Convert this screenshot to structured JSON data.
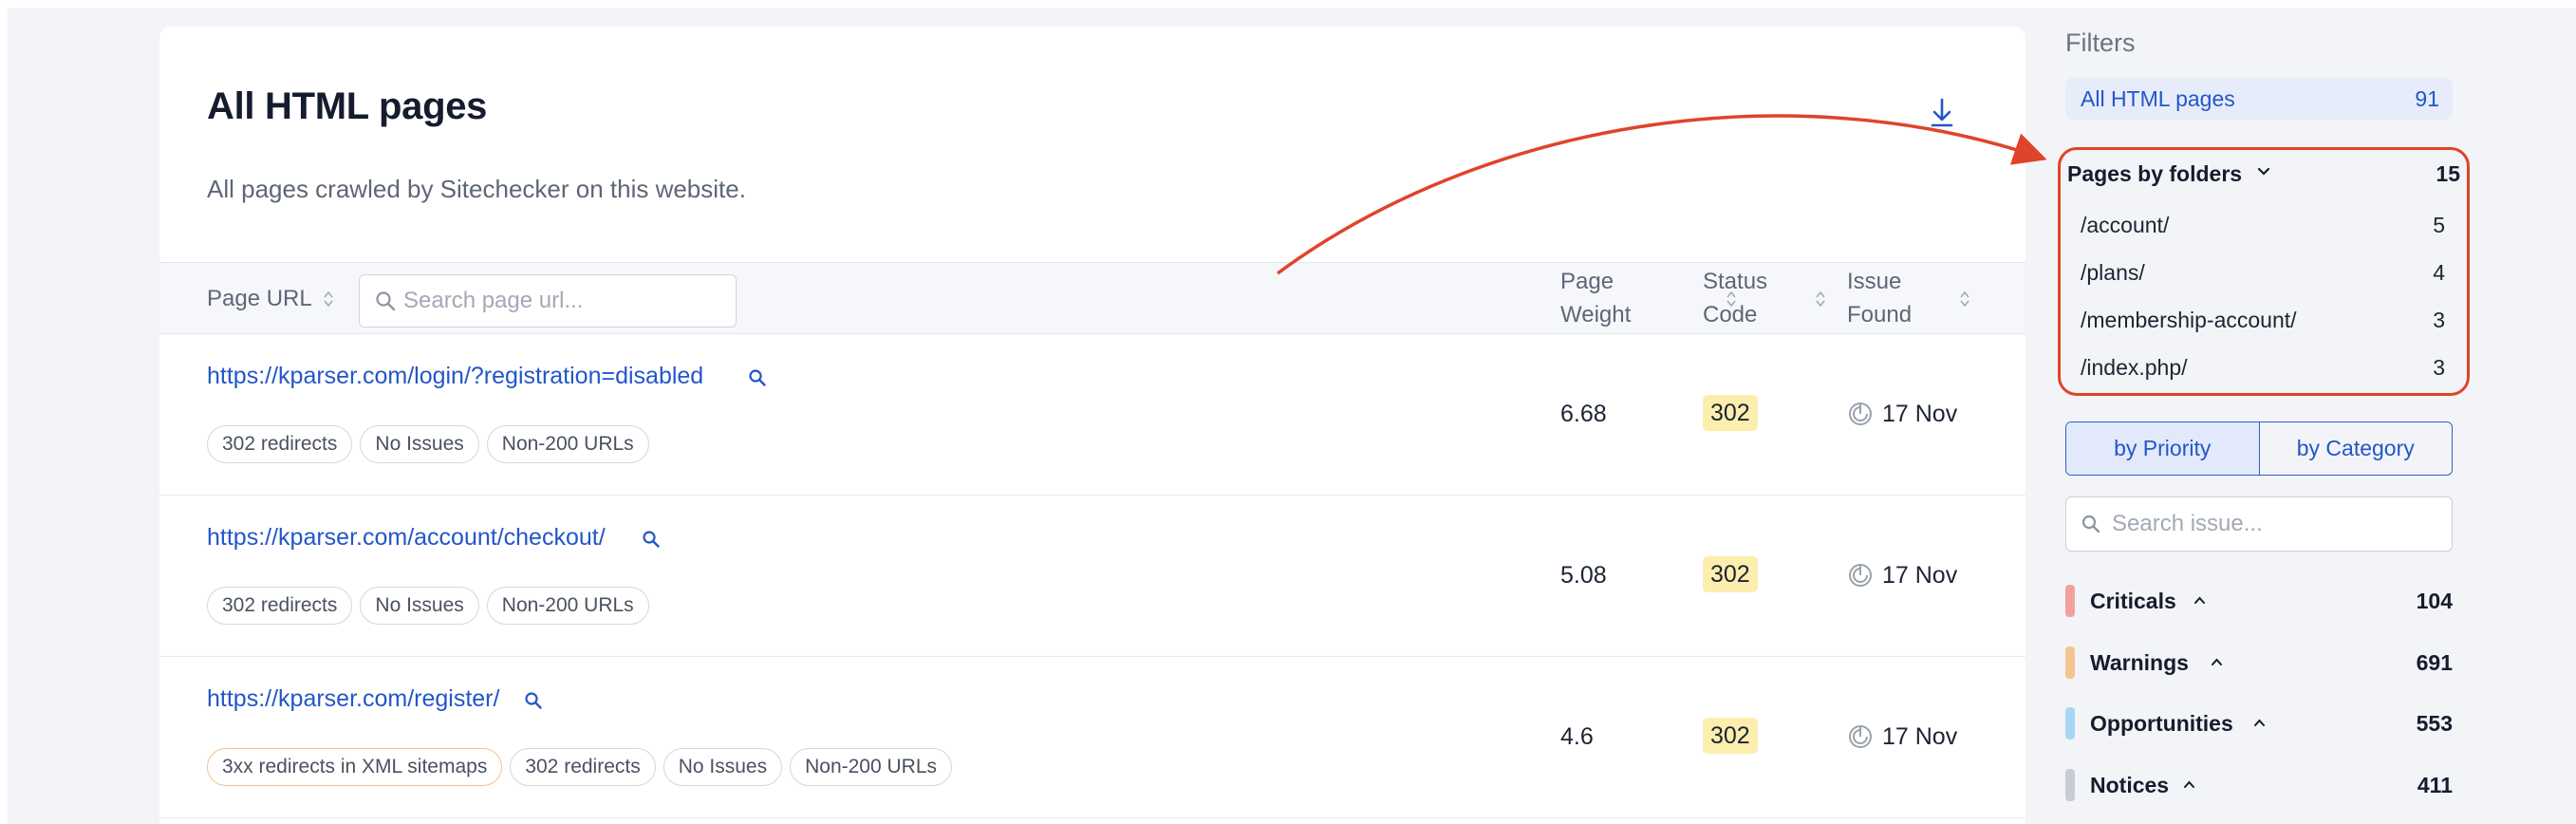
{
  "main": {
    "title": "All HTML pages",
    "subtitle": "All pages crawled by Sitechecker on this website.",
    "download_icon": "download-icon",
    "table": {
      "headers": {
        "page_url": "Page URL",
        "search_placeholder": "Search page url...",
        "page_weight": [
          "Page",
          "Weight"
        ],
        "status_code": [
          "Status",
          "Code"
        ],
        "issue_found": [
          "Issue",
          "Found"
        ]
      },
      "rows": [
        {
          "url": "https://kparser.com/login/?registration=disabled",
          "tags": [
            {
              "label": "302 redirects",
              "style": "gray"
            },
            {
              "label": "No Issues",
              "style": "gray"
            },
            {
              "label": "Non-200 URLs",
              "style": "gray"
            }
          ],
          "weight": "6.68",
          "status": "302",
          "issue_date": "17 Nov"
        },
        {
          "url": "https://kparser.com/account/checkout/",
          "tags": [
            {
              "label": "302 redirects",
              "style": "gray"
            },
            {
              "label": "No Issues",
              "style": "gray"
            },
            {
              "label": "Non-200 URLs",
              "style": "gray"
            }
          ],
          "weight": "5.08",
          "status": "302",
          "issue_date": "17 Nov"
        },
        {
          "url": "https://kparser.com/register/",
          "tags": [
            {
              "label": "3xx redirects in XML sitemaps",
              "style": "orange"
            },
            {
              "label": "302 redirects",
              "style": "gray"
            },
            {
              "label": "No Issues",
              "style": "gray"
            },
            {
              "label": "Non-200 URLs",
              "style": "gray"
            }
          ],
          "weight": "4.6",
          "status": "302",
          "issue_date": "17 Nov"
        }
      ]
    }
  },
  "sidebar": {
    "title": "Filters",
    "all_pages": {
      "label": "All HTML pages",
      "count": "91"
    },
    "folders": {
      "label": "Pages by folders",
      "count": "15",
      "items": [
        {
          "label": "/account/",
          "count": "5"
        },
        {
          "label": "/plans/",
          "count": "4"
        },
        {
          "label": "/membership-account/",
          "count": "3"
        },
        {
          "label": "/index.php/",
          "count": "3"
        }
      ]
    },
    "tabs": [
      {
        "label": "by Priority",
        "active": true
      },
      {
        "label": "by Category",
        "active": false
      }
    ],
    "search_placeholder": "Search issue...",
    "priorities": [
      {
        "label": "Criticals",
        "count": "104",
        "color": "#f2a1a1"
      },
      {
        "label": "Warnings",
        "count": "691",
        "color": "#f6c48f"
      },
      {
        "label": "Opportunities",
        "count": "553",
        "color": "#a9d6f5"
      },
      {
        "label": "Notices",
        "count": "411",
        "color": "#c8ccd4"
      }
    ]
  },
  "colors": {
    "accent": "#2356c9",
    "highlight": "#e0432b",
    "status_badge": "#fdeead"
  }
}
